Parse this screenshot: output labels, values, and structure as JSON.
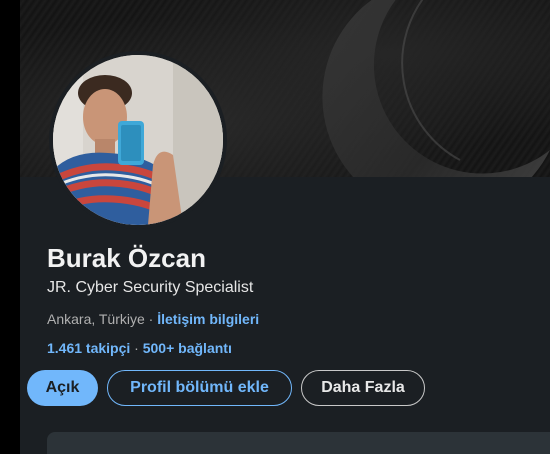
{
  "profile": {
    "name": "Burak Özcan",
    "headline": "JR. Cyber Security Specialist",
    "location": "Ankara, Türkiye",
    "location_separator": "·",
    "contact_link": "İletişim bilgileri",
    "followers": "1.461 takipçi",
    "stats_separator": "·",
    "connections": "500+ bağlantı"
  },
  "actions": {
    "open_label": "Açık",
    "add_section_label": "Profil bölümü ekle",
    "more_label": "Daha Fazla"
  },
  "colors": {
    "accent": "#71b7fb",
    "card_background": "#1b1f23",
    "page_background": "#000000"
  },
  "icons": {
    "cover_graphic": "crescent-moon-icon"
  }
}
